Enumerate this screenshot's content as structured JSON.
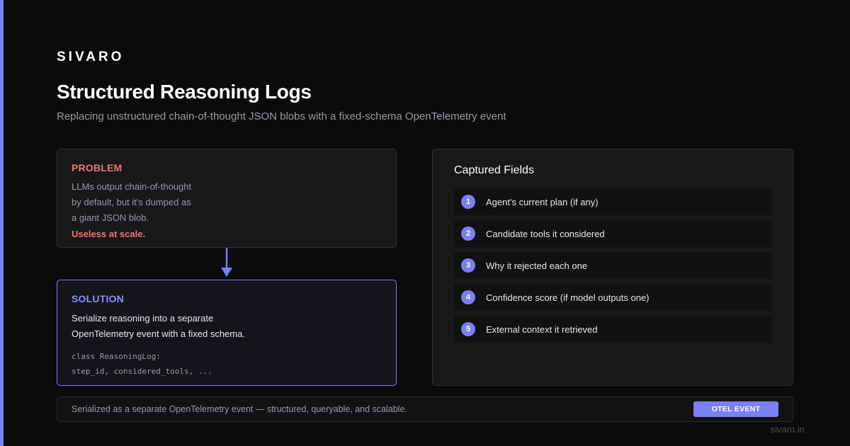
{
  "brand": "SIVARO",
  "title": "Structured Reasoning Logs",
  "subtitle": "Replacing unstructured chain-of-thought JSON blobs with a fixed-schema OpenTelemetry event",
  "problem": {
    "label": "PROBLEM",
    "lines": [
      "LLMs output chain-of-thought",
      "by default, but it's dumped as",
      "a giant JSON blob."
    ],
    "emphasis": "Useless at scale."
  },
  "solution": {
    "label": "SOLUTION",
    "lines": [
      "Serialize reasoning into a separate",
      "OpenTelemetry event with a fixed schema."
    ],
    "code": [
      "class ReasoningLog:",
      "step_id, considered_tools, ..."
    ]
  },
  "fields": {
    "title": "Captured Fields",
    "items": [
      {
        "num": "1",
        "text": "Agent's current plan (if any)"
      },
      {
        "num": "2",
        "text": "Candidate tools it considered"
      },
      {
        "num": "3",
        "text": "Why it rejected each one"
      },
      {
        "num": "4",
        "text": "Confidence score (if model outputs one)"
      },
      {
        "num": "5",
        "text": "External context it retrieved"
      }
    ]
  },
  "footer": {
    "text": "Serialized as a separate OpenTelemetry event — structured, queryable, and scalable.",
    "badge": "OTEL EVENT"
  },
  "site": "sivaro.in",
  "colors": {
    "accent": "#7b80f0",
    "problem": "#f07474",
    "background": "#0b0b0c"
  },
  "icons": {
    "flow_arrow": "arrow-down-icon"
  }
}
